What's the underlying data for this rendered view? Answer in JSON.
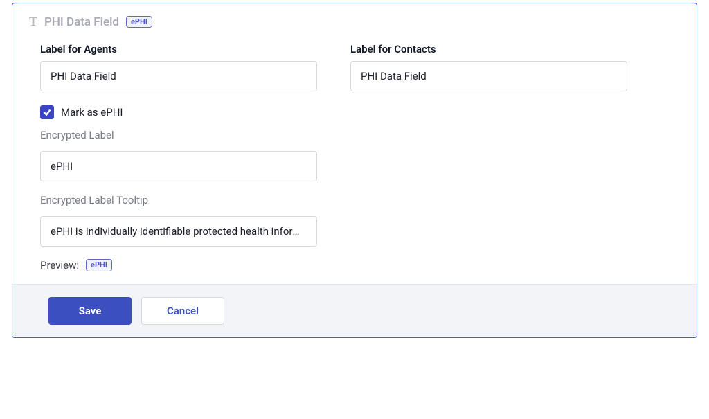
{
  "header": {
    "icon": "T",
    "title": "PHI Data Field",
    "badge": "ePHI"
  },
  "fields": {
    "label_agents": {
      "label": "Label for Agents",
      "value": "PHI Data Field"
    },
    "label_contacts": {
      "label": "Label for Contacts",
      "value": "PHI Data Field"
    },
    "mark_ephi": {
      "label": "Mark as ePHI",
      "checked": true
    },
    "encrypted_label": {
      "label": "Encrypted Label",
      "value": "ePHI"
    },
    "encrypted_tooltip": {
      "label": "Encrypted Label Tooltip",
      "value": "ePHI is individually identifiable protected health information"
    },
    "preview": {
      "label": "Preview:",
      "badge": "ePHI"
    }
  },
  "actions": {
    "save": "Save",
    "cancel": "Cancel"
  }
}
